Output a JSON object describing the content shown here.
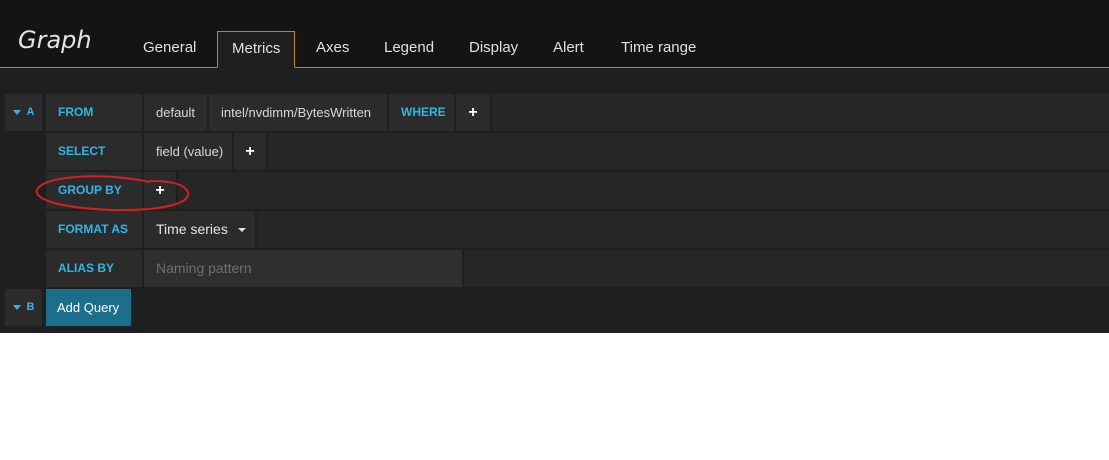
{
  "header": {
    "title": "Graph",
    "tabs": [
      {
        "label": "General"
      },
      {
        "label": "Metrics"
      },
      {
        "label": "Axes"
      },
      {
        "label": "Legend"
      },
      {
        "label": "Display"
      },
      {
        "label": "Alert"
      },
      {
        "label": "Time range"
      }
    ],
    "active_tab": "Metrics"
  },
  "query_a": {
    "ref": "A",
    "from_label": "FROM",
    "policy": "default",
    "measurement": "intel/nvdimm/BytesWritten",
    "where_label": "WHERE",
    "select_label": "SELECT",
    "select_field": "field (value)",
    "group_by_label": "GROUP BY",
    "format_as_label": "FORMAT AS",
    "format_value": "Time series",
    "alias_by_label": "ALIAS BY",
    "alias_placeholder": "Naming pattern",
    "plus": "+"
  },
  "query_b": {
    "ref": "B",
    "add_query_label": "Add Query"
  },
  "colors": {
    "accent_keyword": "#33b5e5",
    "tab_border": "#b88b2a",
    "add_query_bg": "#1b6e8c",
    "annotation": "#d42020"
  }
}
